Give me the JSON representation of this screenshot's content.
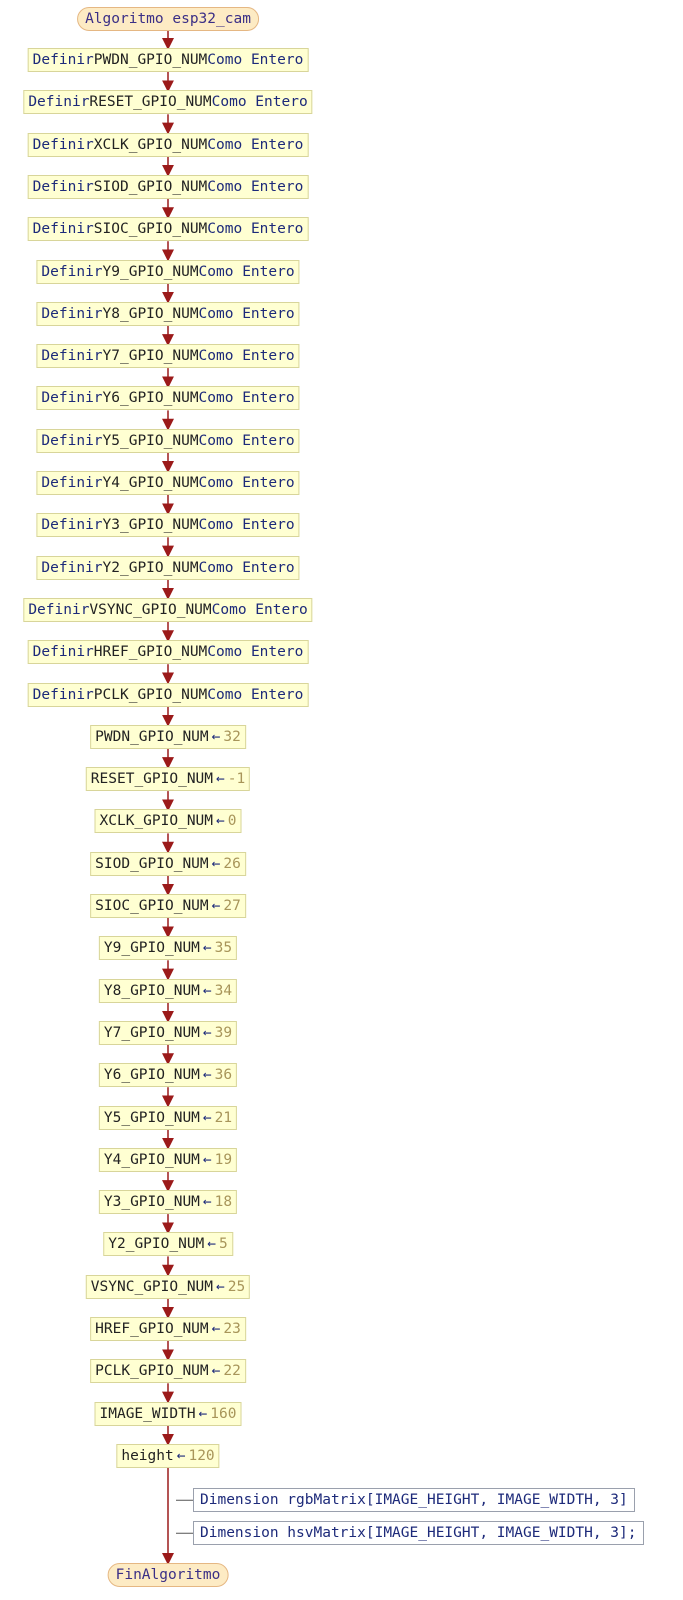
{
  "start_label": "Algoritmo esp32_cam",
  "end_label": "FinAlgoritmo",
  "define_keyword": "Definir",
  "define_type": "Como Entero",
  "definitions": [
    "PWDN_GPIO_NUM",
    "RESET_GPIO_NUM",
    "XCLK_GPIO_NUM",
    "SIOD_GPIO_NUM",
    "SIOC_GPIO_NUM",
    "Y9_GPIO_NUM",
    "Y8_GPIO_NUM",
    "Y7_GPIO_NUM",
    "Y6_GPIO_NUM",
    "Y5_GPIO_NUM",
    "Y4_GPIO_NUM",
    "Y3_GPIO_NUM",
    "Y2_GPIO_NUM",
    "VSYNC_GPIO_NUM",
    "HREF_GPIO_NUM",
    "PCLK_GPIO_NUM"
  ],
  "assign_operator": "←",
  "assignments": [
    {
      "name": "PWDN_GPIO_NUM",
      "value": "32"
    },
    {
      "name": "RESET_GPIO_NUM",
      "value": "-1"
    },
    {
      "name": "XCLK_GPIO_NUM",
      "value": "0"
    },
    {
      "name": "SIOD_GPIO_NUM",
      "value": "26"
    },
    {
      "name": "SIOC_GPIO_NUM",
      "value": "27"
    },
    {
      "name": "Y9_GPIO_NUM",
      "value": "35"
    },
    {
      "name": "Y8_GPIO_NUM",
      "value": "34"
    },
    {
      "name": "Y7_GPIO_NUM",
      "value": "39"
    },
    {
      "name": "Y6_GPIO_NUM",
      "value": "36"
    },
    {
      "name": "Y5_GPIO_NUM",
      "value": "21"
    },
    {
      "name": "Y4_GPIO_NUM",
      "value": "19"
    },
    {
      "name": "Y3_GPIO_NUM",
      "value": "18"
    },
    {
      "name": "Y2_GPIO_NUM",
      "value": "5"
    },
    {
      "name": "VSYNC_GPIO_NUM",
      "value": "25"
    },
    {
      "name": "HREF_GPIO_NUM",
      "value": "23"
    },
    {
      "name": "PCLK_GPIO_NUM",
      "value": "22"
    },
    {
      "name": "IMAGE_WIDTH",
      "value": "160"
    },
    {
      "name": "height",
      "value": "120"
    }
  ],
  "dimension_statements": [
    "Dimension rgbMatrix[IMAGE_HEIGHT, IMAGE_WIDTH, 3]",
    "Dimension hsvMatrix[IMAGE_HEIGHT, IMAGE_WIDTH, 3];"
  ],
  "colors": {
    "flow_line": "#9b1a1a",
    "process_fill": "#ffffd2",
    "terminal_fill": "#fdebc4",
    "keyword": "#1d2a7a",
    "number": "#a8955a"
  }
}
